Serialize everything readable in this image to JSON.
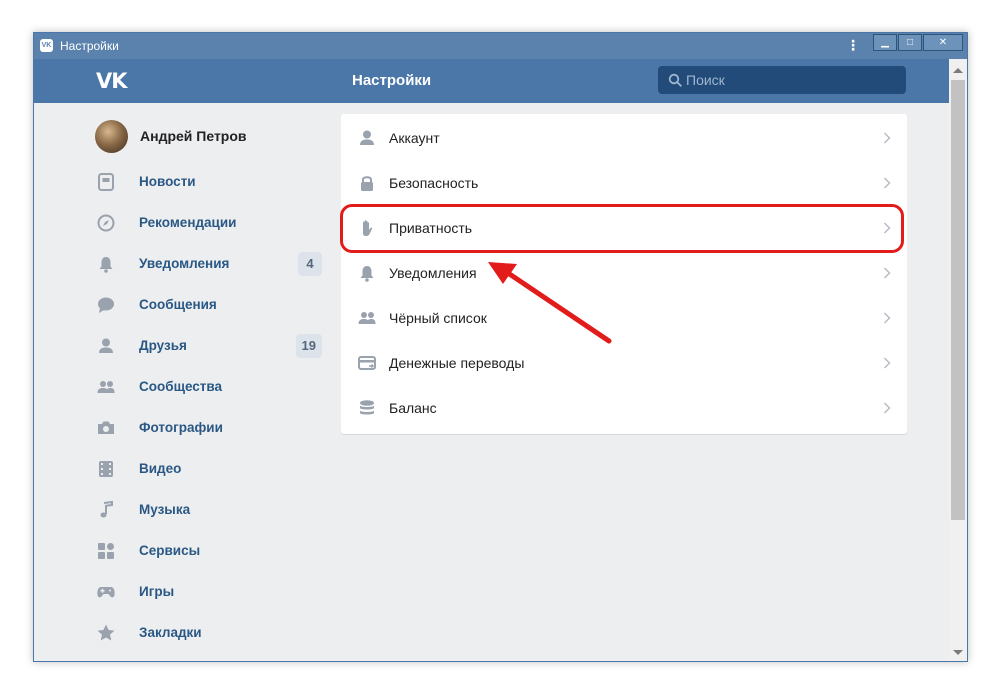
{
  "window": {
    "title": "Настройки",
    "app_icon_text": "VK",
    "menu_dots": "⋮",
    "minimize_glyph": "▁",
    "maximize_glyph": "□",
    "close_glyph": "✕"
  },
  "header": {
    "logo": "VK",
    "title": "Настройки",
    "search_placeholder": "Поиск"
  },
  "sidebar": {
    "profile_name": "Андрей Петров",
    "items": [
      {
        "label": "Новости",
        "icon": "news-icon",
        "badge": ""
      },
      {
        "label": "Рекомендации",
        "icon": "compass-icon",
        "badge": ""
      },
      {
        "label": "Уведомления",
        "icon": "bell-icon",
        "badge": "4"
      },
      {
        "label": "Сообщения",
        "icon": "message-icon",
        "badge": ""
      },
      {
        "label": "Друзья",
        "icon": "person-icon",
        "badge": "19"
      },
      {
        "label": "Сообщества",
        "icon": "people-icon",
        "badge": ""
      },
      {
        "label": "Фотографии",
        "icon": "camera-icon",
        "badge": ""
      },
      {
        "label": "Видео",
        "icon": "film-icon",
        "badge": ""
      },
      {
        "label": "Музыка",
        "icon": "music-note-icon",
        "badge": ""
      },
      {
        "label": "Сервисы",
        "icon": "grid-icon",
        "badge": ""
      },
      {
        "label": "Игры",
        "icon": "gamepad-icon",
        "badge": ""
      },
      {
        "label": "Закладки",
        "icon": "star-icon",
        "badge": ""
      }
    ]
  },
  "settings_menu": {
    "items": [
      {
        "label": "Аккаунт",
        "icon": "person-icon"
      },
      {
        "label": "Безопасность",
        "icon": "lock-icon"
      },
      {
        "label": "Приватность",
        "icon": "hand-icon"
      },
      {
        "label": "Уведомления",
        "icon": "bell-icon"
      },
      {
        "label": "Чёрный список",
        "icon": "people-icon"
      },
      {
        "label": "Денежные переводы",
        "icon": "card-transfer-icon"
      },
      {
        "label": "Баланс",
        "icon": "coins-icon"
      }
    ]
  },
  "annotation": {
    "highlight_color": "#e21b1b",
    "highlighted_item": "Приватность"
  },
  "colors": {
    "header": "#4a76a8",
    "titlebar": "#5b82ad",
    "nav_text": "#2a5885",
    "icon": "#99a2ad",
    "background": "#edeef0"
  }
}
